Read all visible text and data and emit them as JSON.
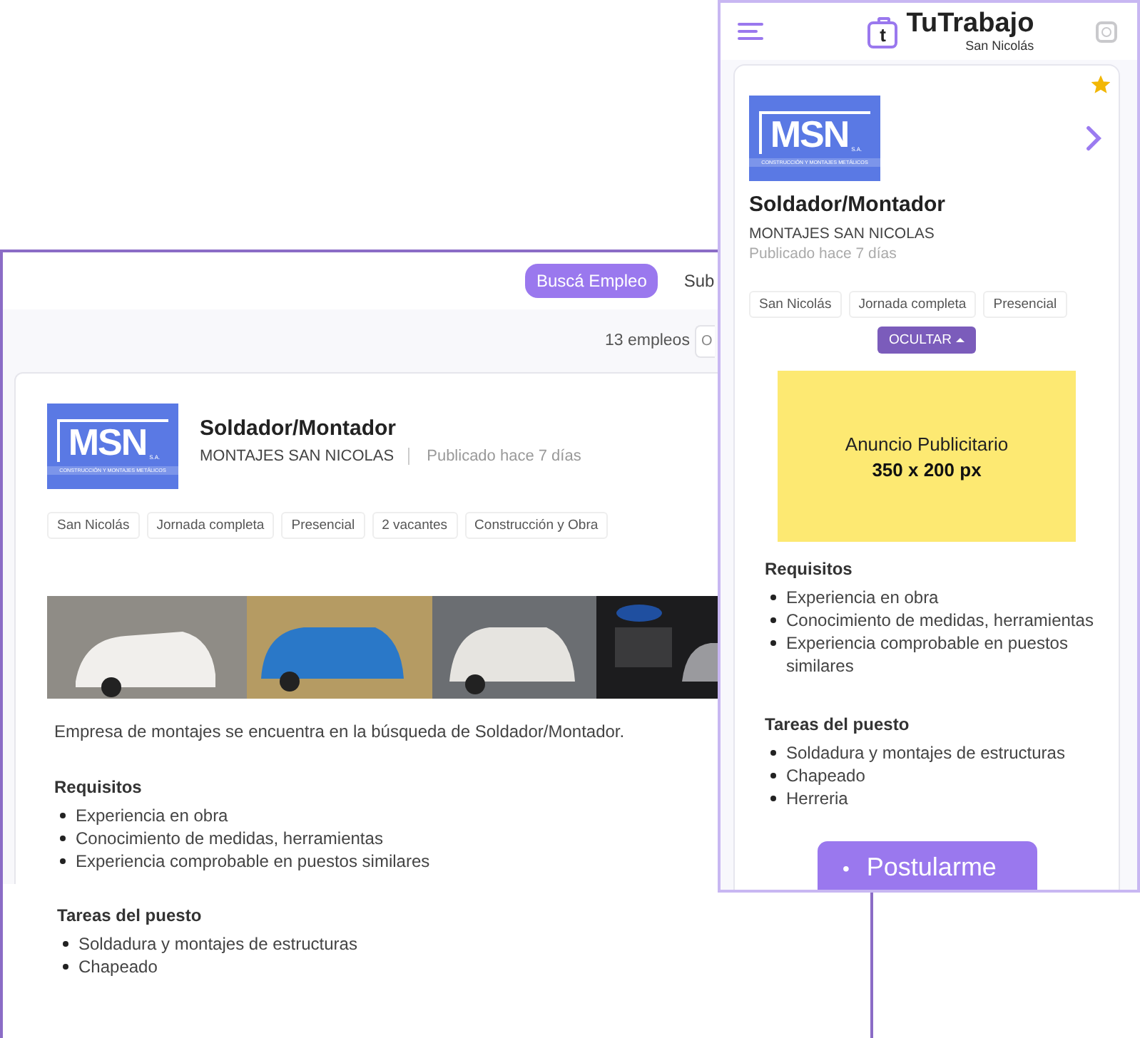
{
  "desktop": {
    "nav": {
      "tabs": [
        {
          "label": "Buscá Empleo",
          "selected": true
        },
        {
          "label": "Sub",
          "selected": false
        }
      ]
    },
    "toolbar": {
      "count": "13 empleos",
      "sort_field": "O"
    },
    "job": {
      "logo": {
        "mark": "MSN",
        "suffix": "S.A.",
        "tagline": "CONSTRUCCIÓN Y MONTAJES METÁLICOS"
      },
      "title": "Soldador/Montador",
      "company": "MONTAJES SAN NICOLAS",
      "posted": "Publicado hace 7 días",
      "tags": [
        "San Nicolás",
        "Jornada completa",
        "Presencial",
        "2 vacantes",
        "Construcción y Obra"
      ],
      "description": "Empresa de montajes se encuentra en la búsqueda de Soldador/Montador.",
      "sections": [
        {
          "heading": "Requisitos",
          "items": [
            "Experiencia en obra",
            "Conocimiento de medidas, herramientas",
            "Experiencia comprobable en puestos similares"
          ]
        }
      ]
    },
    "below": {
      "sections": [
        {
          "heading": "Tareas del puesto",
          "items": [
            "Soldadura y montajes de estructuras",
            "Chapeado"
          ]
        }
      ]
    }
  },
  "mobile": {
    "header": {
      "logo_letter": "t",
      "brand": "TuTrabajo",
      "city": "San Nicolás"
    },
    "job": {
      "favorite": true,
      "logo": {
        "mark": "MSN",
        "suffix": "S.A.",
        "tagline": "CONSTRUCCIÓN Y MONTAJES METÁLICOS"
      },
      "title": "Soldador/Montador",
      "company": "MONTAJES SAN NICOLAS",
      "posted": "Publicado hace 7 días",
      "tags": [
        "San Nicolás",
        "Jornada completa",
        "Presencial"
      ],
      "hide_button": {
        "label": "OCULTAR",
        "expanded": true
      },
      "ad": {
        "line1": "Anuncio Publicitario",
        "line2": "350 x 200 px"
      },
      "sections": [
        {
          "heading": "Requisitos",
          "items": [
            "Experiencia en obra",
            "Conocimiento de medidas, herramientas",
            "Experiencia comprobable en puestos similares"
          ]
        },
        {
          "heading": "Tareas del puesto",
          "items": [
            "Soldadura y montajes de estructuras",
            "Chapeado",
            "Herreria"
          ]
        }
      ],
      "apply_button": {
        "bullet": "•",
        "label": "Postularme"
      }
    }
  }
}
